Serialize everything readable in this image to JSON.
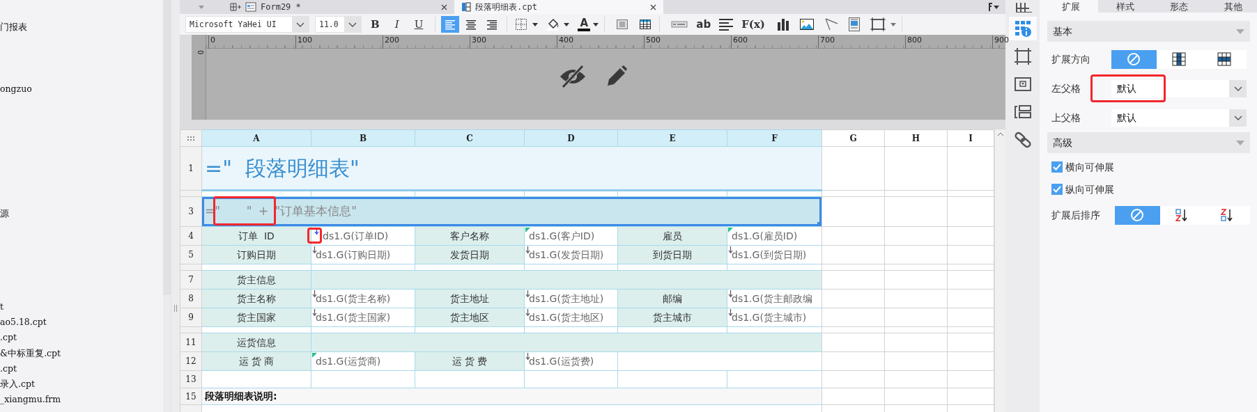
{
  "file_tree": {
    "items": [
      {
        "name": "门报表"
      },
      {
        "name": "ongzuo"
      },
      {
        "name": "源"
      },
      {
        "name": "t"
      },
      {
        "name": "ao5.18.cpt"
      },
      {
        "name": ".cpt"
      },
      {
        "name": "&中标重复.cpt"
      },
      {
        "name": ".cpt"
      },
      {
        "name": "录入.cpt"
      },
      {
        "name": "_xiangmu.frm"
      }
    ]
  },
  "tabs": [
    {
      "label": "Form29 *",
      "kind": "form",
      "selected": false
    },
    {
      "label": "段落明细表.cpt",
      "kind": "report",
      "selected": true
    }
  ],
  "toolbar": {
    "font": "Microsoft YaHei UI",
    "size": "11.0",
    "items": [
      {
        "kind": "bold",
        "label": "B"
      },
      {
        "kind": "italic",
        "label": "I"
      },
      {
        "kind": "underline",
        "label": "U"
      },
      {
        "kind": "divider"
      },
      {
        "kind": "align-left",
        "selected": true
      },
      {
        "kind": "align-center",
        "selected": false
      },
      {
        "kind": "align-right",
        "selected": false
      },
      {
        "kind": "divider"
      },
      {
        "kind": "border"
      },
      {
        "kind": "fill"
      },
      {
        "kind": "font-color",
        "label": "A"
      },
      {
        "kind": "divider"
      },
      {
        "kind": "merge"
      },
      {
        "kind": "table"
      },
      {
        "kind": "divider"
      },
      {
        "kind": "widget"
      },
      {
        "kind": "text",
        "label": "ab"
      },
      {
        "kind": "paragraph"
      },
      {
        "kind": "formula",
        "label": "F(x)"
      },
      {
        "kind": "chart"
      },
      {
        "kind": "image"
      },
      {
        "kind": "slash"
      },
      {
        "kind": "report"
      },
      {
        "kind": "frame"
      },
      {
        "kind": "divider"
      }
    ]
  },
  "ruler": {
    "ticks": [
      "0",
      "100",
      "200",
      "300",
      "400",
      "500",
      "600",
      "700",
      "800",
      "900"
    ],
    "vertical": "0"
  },
  "sheet": {
    "columns": [
      "A",
      "B",
      "C",
      "D",
      "E",
      "F",
      "G",
      "H",
      "I"
    ],
    "rows": [
      {
        "number": "1",
        "kind": "title",
        "text": "=\"  段落明细表\""
      },
      {
        "kind": "gap"
      },
      {
        "number": "3",
        "kind": "heading",
        "text": "=\"    \" + \"订单基本信息\"",
        "selected": true,
        "highlighted": true
      },
      {
        "number": "4",
        "kind": "fields",
        "cells": [
          {
            "kind": "label",
            "text": "订单  ID"
          },
          {
            "kind": "value",
            "text": "ds1.G(订单ID)",
            "expands": true,
            "flagged": false,
            "highlighted": true
          },
          {
            "kind": "label",
            "text": "客户名称"
          },
          {
            "kind": "value",
            "text": "ds1.G(客户ID)",
            "expands": false,
            "flagged": true,
            "highlighted": false
          },
          {
            "kind": "label",
            "text": "雇员"
          },
          {
            "kind": "value",
            "text": "ds1.G(雇员ID)",
            "expands": false,
            "flagged": true,
            "highlighted": false
          }
        ]
      },
      {
        "number": "5",
        "kind": "fields",
        "cells": [
          {
            "kind": "label",
            "text": "订购日期"
          },
          {
            "kind": "value",
            "text": "ds1.G(订购日期)",
            "expands": true,
            "flagged": false,
            "highlighted": false
          },
          {
            "kind": "label",
            "text": "发货日期"
          },
          {
            "kind": "value",
            "text": "ds1.G(发货日期)",
            "expands": true,
            "flagged": false,
            "highlighted": false
          },
          {
            "kind": "label",
            "text": "到货日期"
          },
          {
            "kind": "value",
            "text": "ds1.G(到货日期)",
            "expands": true,
            "flagged": false,
            "highlighted": false
          }
        ]
      },
      {
        "kind": "gap"
      },
      {
        "number": "7",
        "kind": "section",
        "text": "货主信息"
      },
      {
        "number": "8",
        "kind": "fields",
        "cells": [
          {
            "kind": "label",
            "text": "货主名称"
          },
          {
            "kind": "value",
            "text": "ds1.G(货主名称)",
            "expands": true,
            "flagged": false,
            "highlighted": false
          },
          {
            "kind": "label",
            "text": "货主地址"
          },
          {
            "kind": "value",
            "text": "ds1.G(货主地址)",
            "expands": true,
            "flagged": false,
            "highlighted": false
          },
          {
            "kind": "label",
            "text": "邮编"
          },
          {
            "kind": "value",
            "text": "ds1.G(货主邮政编",
            "expands": true,
            "flagged": false,
            "highlighted": false
          }
        ]
      },
      {
        "number": "9",
        "kind": "fields",
        "cells": [
          {
            "kind": "label",
            "text": "货主国家"
          },
          {
            "kind": "value",
            "text": "ds1.G(货主国家)",
            "expands": true,
            "flagged": false,
            "highlighted": false
          },
          {
            "kind": "label",
            "text": "货主地区"
          },
          {
            "kind": "value",
            "text": "ds1.G(货主地区)",
            "expands": true,
            "flagged": false,
            "highlighted": false
          },
          {
            "kind": "label",
            "text": "货主城市"
          },
          {
            "kind": "value",
            "text": "ds1.G(货主城市)",
            "expands": true,
            "flagged": false,
            "highlighted": false
          }
        ]
      },
      {
        "kind": "gap"
      },
      {
        "number": "11",
        "kind": "section",
        "text": "运货信息"
      },
      {
        "number": "12",
        "kind": "fields",
        "cells": [
          {
            "kind": "label",
            "text": "运 货 商"
          },
          {
            "kind": "value",
            "text": "ds1.G(运货商)",
            "expands": false,
            "flagged": true,
            "highlighted": false
          },
          {
            "kind": "label",
            "text": "运 货 费"
          },
          {
            "kind": "value",
            "text": "ds1.G(运货费)",
            "expands": true,
            "flagged": false,
            "highlighted": false
          }
        ]
      },
      {
        "number": "13",
        "kind": "empty"
      },
      {
        "number": "15",
        "kind": "note",
        "text": "段落明细表说明:"
      }
    ]
  },
  "side_icons": [
    {
      "kind": "layout",
      "selected": false
    },
    {
      "kind": "cell-attributes",
      "selected": true
    },
    {
      "kind": "frame",
      "selected": false
    },
    {
      "kind": "widget",
      "selected": false
    },
    {
      "kind": "stack",
      "selected": false
    },
    {
      "kind": "link",
      "selected": false
    }
  ],
  "properties": {
    "tabs": [
      {
        "label": "扩展",
        "selected": true
      },
      {
        "label": "样式",
        "selected": false
      },
      {
        "label": "形态",
        "selected": false
      },
      {
        "label": "其他",
        "selected": false
      }
    ],
    "sections": [
      {
        "title": "基本",
        "fields": [
          {
            "kind": "segmented",
            "label": "扩展方向",
            "options": [
              {
                "kind": "none",
                "selected": true
              },
              {
                "kind": "vertical",
                "selected": false
              },
              {
                "kind": "horizontal",
                "selected": false
              }
            ]
          },
          {
            "kind": "select",
            "label": "左父格",
            "value": "默认",
            "highlighted": true
          },
          {
            "kind": "select",
            "label": "上父格",
            "value": "默认",
            "highlighted": false
          }
        ]
      },
      {
        "title": "高级",
        "fields": [
          {
            "kind": "checkbox",
            "label": "横向可伸展",
            "checked": true
          },
          {
            "kind": "checkbox",
            "label": "纵向可伸展",
            "checked": true
          },
          {
            "kind": "segmented",
            "label": "扩展后排序",
            "options": [
              {
                "kind": "none",
                "selected": true
              },
              {
                "kind": "ascending",
                "selected": false
              },
              {
                "kind": "descending",
                "selected": false
              }
            ]
          }
        ]
      }
    ]
  }
}
